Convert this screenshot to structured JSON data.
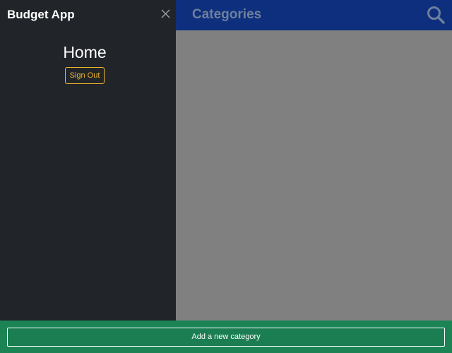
{
  "header": {
    "title": "Categories",
    "search_icon": "search-icon"
  },
  "sidebar": {
    "brand": "Budget App",
    "close_icon": "close-icon",
    "heading": "Home",
    "signout_label": "Sign Out"
  },
  "footer": {
    "add_label": "Add a new category"
  },
  "colors": {
    "header_bg": "#0d2f7e",
    "sidebar_bg": "#212529",
    "overlay_bg": "#808080",
    "footer_bg": "#1c8454",
    "accent_warning": "#f0b52b"
  }
}
